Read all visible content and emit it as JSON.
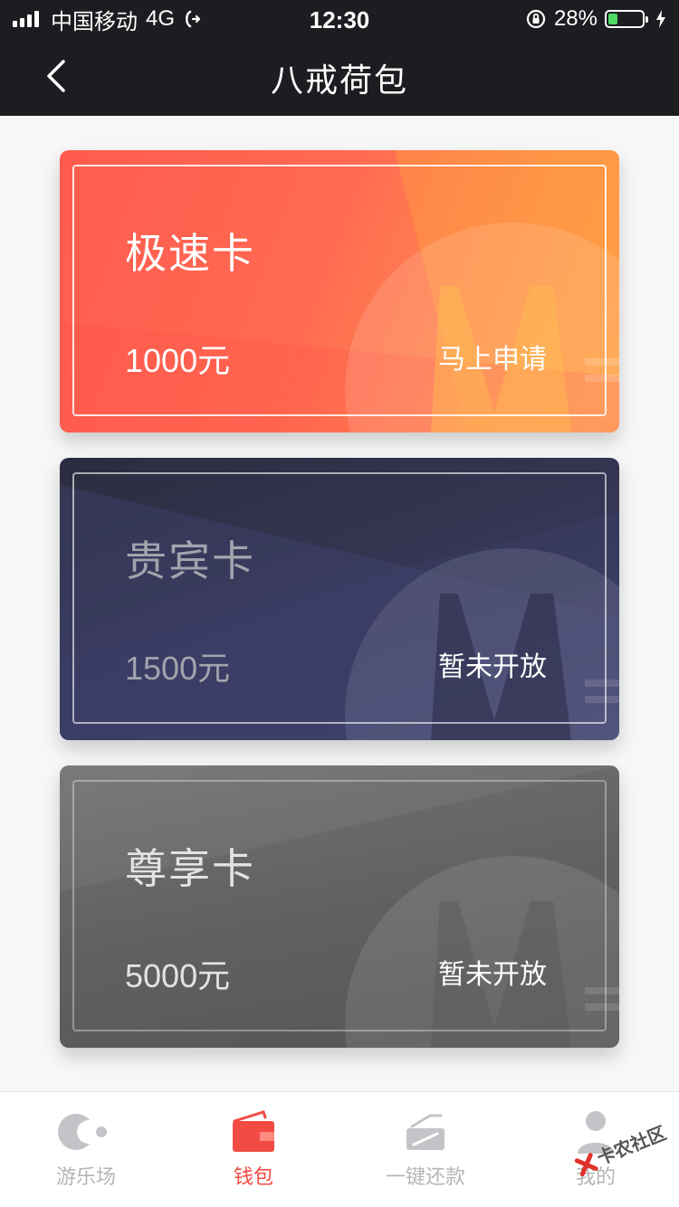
{
  "status_bar": {
    "carrier": "中国移动",
    "network": "4G",
    "time": "12:30",
    "battery": "28%",
    "battery_level": 0.28
  },
  "header": {
    "title": "八戒荷包",
    "back_icon": "chevron-left-icon"
  },
  "cards": [
    {
      "name": "极速卡",
      "amount": "1000元",
      "action": "马上申请",
      "colors": [
        "#ff5b4e",
        "#ff9e47"
      ]
    },
    {
      "name": "贵宾卡",
      "amount": "1500元",
      "action": "暂未开放",
      "colors": [
        "#2c2c40",
        "#3e3f68"
      ]
    },
    {
      "name": "尊享卡",
      "amount": "5000元",
      "action": "暂未开放",
      "colors": [
        "#7a7a7a",
        "#5a5a5a"
      ]
    }
  ],
  "tabbar": {
    "items": [
      {
        "label": "游乐场",
        "icon": "playground-icon",
        "active": false
      },
      {
        "label": "钱包",
        "icon": "wallet-icon",
        "active": true
      },
      {
        "label": "一键还款",
        "icon": "repay-icon",
        "active": false
      },
      {
        "label": "我的",
        "icon": "profile-icon",
        "active": false
      }
    ],
    "active_color": "#f24b43",
    "inactive_color": "#b5b5b5"
  },
  "watermark": {
    "text": "卡农社区"
  }
}
